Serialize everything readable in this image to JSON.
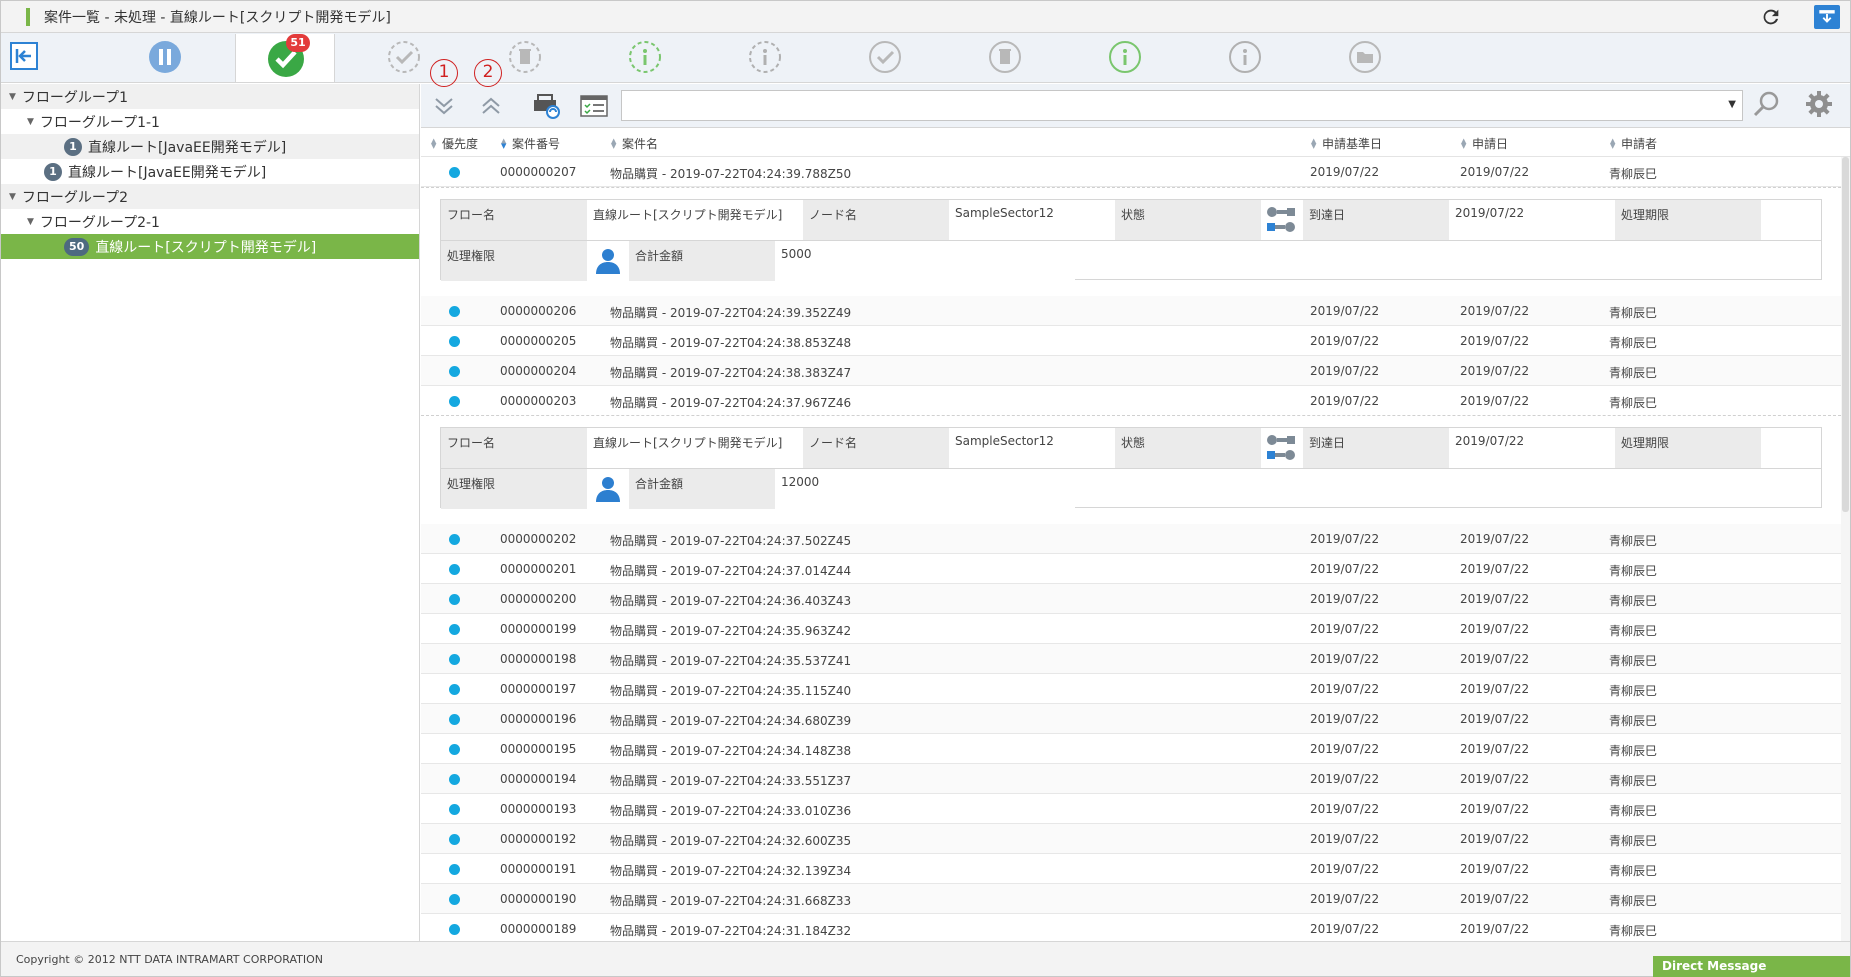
{
  "window": {
    "title": "案件一覧 - 未処理 - 直線ルート[スクリプト開発モデル]"
  },
  "iconbar": {
    "active_badge": "51"
  },
  "annotations": [
    "1",
    "2"
  ],
  "sidebar": {
    "items": [
      {
        "label": "フローグループ1",
        "kind": "group"
      },
      {
        "label": "フローグループ1-1",
        "kind": "subgroup"
      },
      {
        "label": "直線ルート[JavaEE開発モデル]",
        "count": "1",
        "kind": "route"
      },
      {
        "label": "直線ルート[JavaEE開発モデル]",
        "count": "1",
        "kind": "route"
      },
      {
        "label": "フローグループ2",
        "kind": "group"
      },
      {
        "label": "フローグループ2-1",
        "kind": "subgroup"
      },
      {
        "label": "直線ルート[スクリプト開発モデル]",
        "count": "50",
        "kind": "route-selected"
      }
    ]
  },
  "table": {
    "headers": {
      "priority": "優先度",
      "number": "案件番号",
      "name": "案件名",
      "base_date": "申請基準日",
      "apply_date": "申請日",
      "applicant": "申請者"
    },
    "rows": [
      {
        "number": "0000000207",
        "name": "物品購買 - 2019-07-22T04:24:39.788Z50",
        "base_date": "2019/07/22",
        "apply_date": "2019/07/22",
        "applicant": "青柳辰巳"
      },
      {
        "number": "0000000206",
        "name": "物品購買 - 2019-07-22T04:24:39.352Z49",
        "base_date": "2019/07/22",
        "apply_date": "2019/07/22",
        "applicant": "青柳辰巳"
      },
      {
        "number": "0000000205",
        "name": "物品購買 - 2019-07-22T04:24:38.853Z48",
        "base_date": "2019/07/22",
        "apply_date": "2019/07/22",
        "applicant": "青柳辰巳"
      },
      {
        "number": "0000000204",
        "name": "物品購買 - 2019-07-22T04:24:38.383Z47",
        "base_date": "2019/07/22",
        "apply_date": "2019/07/22",
        "applicant": "青柳辰巳"
      },
      {
        "number": "0000000203",
        "name": "物品購買 - 2019-07-22T04:24:37.967Z46",
        "base_date": "2019/07/22",
        "apply_date": "2019/07/22",
        "applicant": "青柳辰巳"
      },
      {
        "number": "0000000202",
        "name": "物品購買 - 2019-07-22T04:24:37.502Z45",
        "base_date": "2019/07/22",
        "apply_date": "2019/07/22",
        "applicant": "青柳辰巳"
      },
      {
        "number": "0000000201",
        "name": "物品購買 - 2019-07-22T04:24:37.014Z44",
        "base_date": "2019/07/22",
        "apply_date": "2019/07/22",
        "applicant": "青柳辰巳"
      },
      {
        "number": "0000000200",
        "name": "物品購買 - 2019-07-22T04:24:36.403Z43",
        "base_date": "2019/07/22",
        "apply_date": "2019/07/22",
        "applicant": "青柳辰巳"
      },
      {
        "number": "0000000199",
        "name": "物品購買 - 2019-07-22T04:24:35.963Z42",
        "base_date": "2019/07/22",
        "apply_date": "2019/07/22",
        "applicant": "青柳辰巳"
      },
      {
        "number": "0000000198",
        "name": "物品購買 - 2019-07-22T04:24:35.537Z41",
        "base_date": "2019/07/22",
        "apply_date": "2019/07/22",
        "applicant": "青柳辰巳"
      },
      {
        "number": "0000000197",
        "name": "物品購買 - 2019-07-22T04:24:35.115Z40",
        "base_date": "2019/07/22",
        "apply_date": "2019/07/22",
        "applicant": "青柳辰巳"
      },
      {
        "number": "0000000196",
        "name": "物品購買 - 2019-07-22T04:24:34.680Z39",
        "base_date": "2019/07/22",
        "apply_date": "2019/07/22",
        "applicant": "青柳辰巳"
      },
      {
        "number": "0000000195",
        "name": "物品購買 - 2019-07-22T04:24:34.148Z38",
        "base_date": "2019/07/22",
        "apply_date": "2019/07/22",
        "applicant": "青柳辰巳"
      },
      {
        "number": "0000000194",
        "name": "物品購買 - 2019-07-22T04:24:33.551Z37",
        "base_date": "2019/07/22",
        "apply_date": "2019/07/22",
        "applicant": "青柳辰巳"
      },
      {
        "number": "0000000193",
        "name": "物品購買 - 2019-07-22T04:24:33.010Z36",
        "base_date": "2019/07/22",
        "apply_date": "2019/07/22",
        "applicant": "青柳辰巳"
      },
      {
        "number": "0000000192",
        "name": "物品購買 - 2019-07-22T04:24:32.600Z35",
        "base_date": "2019/07/22",
        "apply_date": "2019/07/22",
        "applicant": "青柳辰巳"
      },
      {
        "number": "0000000191",
        "name": "物品購買 - 2019-07-22T04:24:32.139Z34",
        "base_date": "2019/07/22",
        "apply_date": "2019/07/22",
        "applicant": "青柳辰巳"
      },
      {
        "number": "0000000190",
        "name": "物品購買 - 2019-07-22T04:24:31.668Z33",
        "base_date": "2019/07/22",
        "apply_date": "2019/07/22",
        "applicant": "青柳辰巳"
      },
      {
        "number": "0000000189",
        "name": "物品購買 - 2019-07-22T04:24:31.184Z32",
        "base_date": "2019/07/22",
        "apply_date": "2019/07/22",
        "applicant": "青柳辰巳"
      }
    ]
  },
  "details": [
    {
      "labels": {
        "flow": "フロー名",
        "node": "ノード名",
        "status": "状態",
        "arrival": "到達日",
        "deadline": "処理期限",
        "authority": "処理権限",
        "total": "合計金額"
      },
      "values": {
        "flow": "直線ルート[スクリプト開発モデル]",
        "node": "SampleSector12",
        "arrival": "2019/07/22",
        "deadline": "",
        "total": "5000"
      }
    },
    {
      "labels": {
        "flow": "フロー名",
        "node": "ノード名",
        "status": "状態",
        "arrival": "到達日",
        "deadline": "処理期限",
        "authority": "処理権限",
        "total": "合計金額"
      },
      "values": {
        "flow": "直線ルート[スクリプト開発モデル]",
        "node": "SampleSector12",
        "arrival": "2019/07/22",
        "deadline": "",
        "total": "12000"
      }
    }
  ],
  "footer": {
    "copyright": "Copyright © 2012 NTT DATA INTRAMART CORPORATION",
    "direct_message": "Direct Message"
  },
  "colors": {
    "accent_green": "#7ab648",
    "dot_blue": "#14a8e0",
    "brand_blue": "#2d82d4",
    "badge_red": "#e33b3b"
  }
}
